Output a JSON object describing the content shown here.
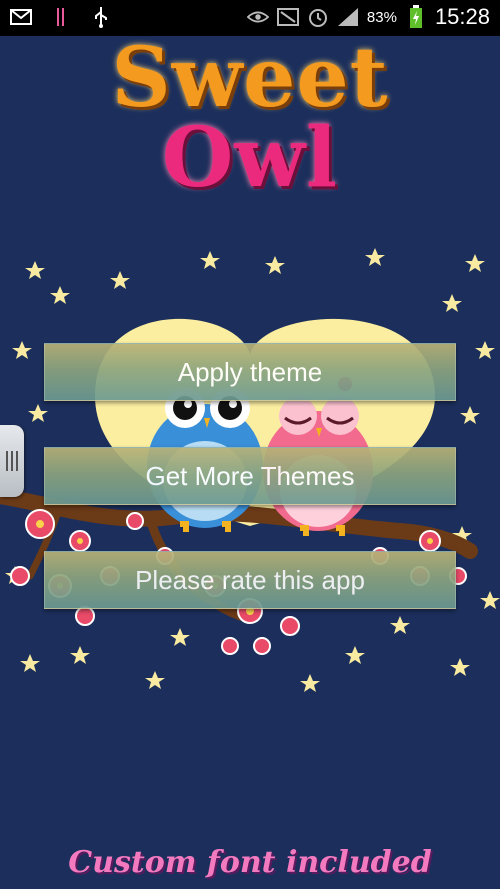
{
  "status_bar": {
    "battery_percent": "83%",
    "time": "15:28",
    "icons": [
      "mail-icon",
      "signal-bars-small-icon",
      "usb-icon",
      "eye-icon",
      "nfc-icon",
      "alarm-icon",
      "cell-signal-icon",
      "battery-charging-icon"
    ]
  },
  "title": {
    "line1": "Sweet",
    "line2": "Owl",
    "color1": "#f39a1f",
    "color2": "#ec2a7d"
  },
  "buttons": {
    "apply": "Apply theme",
    "more": "Get More Themes",
    "rate": "Please rate this app"
  },
  "footer": {
    "text": "Custom font included"
  },
  "colors": {
    "background": "#1c2f5c",
    "moon": "#fbeea0",
    "owl_blue": "#3a8fd9",
    "owl_pink": "#f26b8f",
    "branch": "#6b3a17",
    "blossom": "#e84a68"
  }
}
